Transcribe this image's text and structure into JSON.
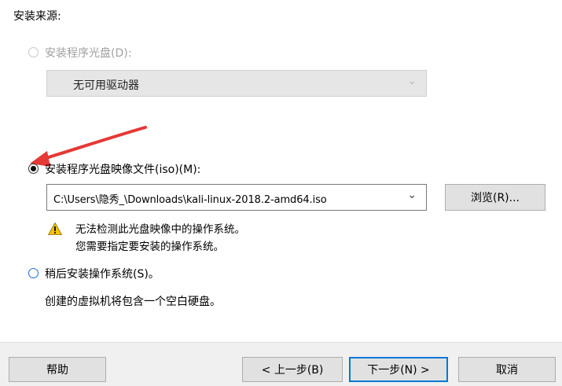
{
  "section": {
    "title": "安装来源:"
  },
  "option_disc": {
    "label": "安装程序光盘(D):",
    "drive_value": "无可用驱动器"
  },
  "option_iso": {
    "label": "安装程序光盘映像文件(iso)(M):",
    "path_value": "C:\\Users\\隐秀_\\Downloads\\kali-linux-2018.2-amd64.iso",
    "browse_label": "浏览(R)...",
    "warning_line1": "无法检测此光盘映像中的操作系统。",
    "warning_line2": "您需要指定要安装的操作系统。"
  },
  "option_later": {
    "label": "稍后安装操作系统(S)。",
    "note": "创建的虚拟机将包含一个空白硬盘。"
  },
  "footer": {
    "help": "帮助",
    "back": "< 上一步(B)",
    "next": "下一步(N) >",
    "cancel": "取消"
  },
  "colors": {
    "accent": "#0078d7",
    "annotation_arrow": "#e53935",
    "warning": "#f5c400"
  }
}
